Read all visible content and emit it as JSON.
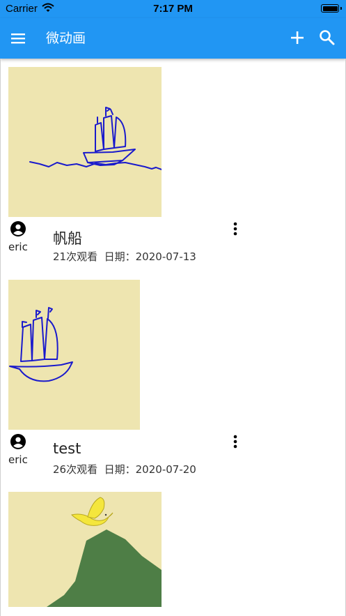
{
  "status_bar": {
    "carrier": "Carrier",
    "time": "7:17 PM"
  },
  "app_bar": {
    "title": "微动画",
    "color": "#2196F3",
    "icons": [
      "menu-icon",
      "add-icon",
      "search-icon"
    ]
  },
  "posts": [
    {
      "title": "帆船",
      "author": "eric",
      "views": "21次观看",
      "date": "日期：2020-07-13",
      "thumbnail": "ship-on-waves",
      "background": "#EEE5B0"
    },
    {
      "title": "test",
      "author": "eric",
      "views": "26次观看",
      "date": "日期：2020-07-20",
      "thumbnail": "ship",
      "background": "#EEE5B0"
    },
    {
      "title": "",
      "author": "",
      "views": "",
      "date": "",
      "thumbnail": "bird-over-hill",
      "background": "#EEE5B0"
    }
  ]
}
